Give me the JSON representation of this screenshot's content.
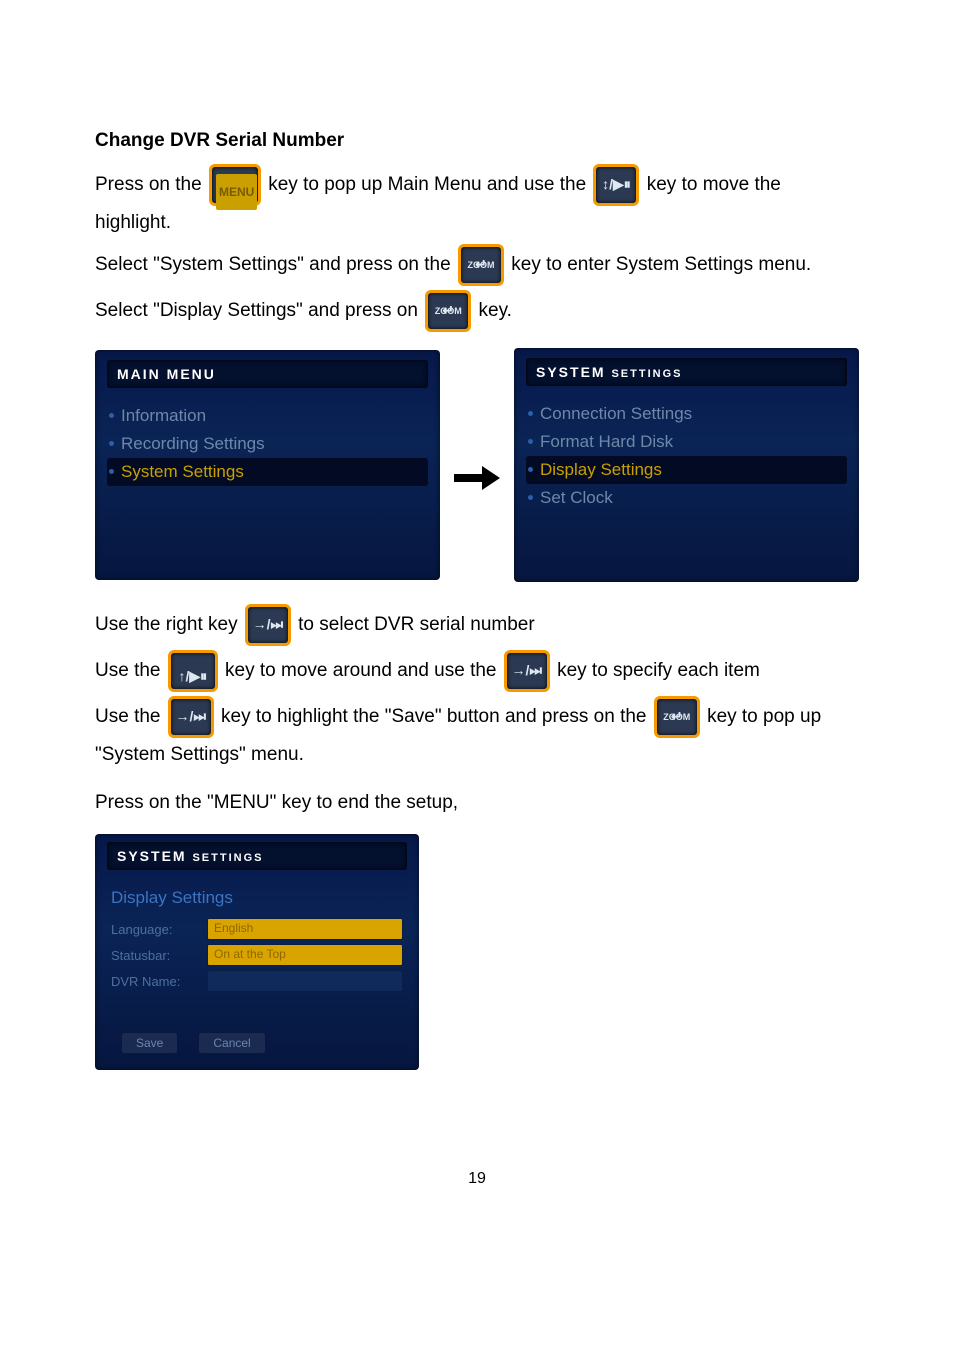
{
  "title": "Change DVR Serial Number",
  "p1": {
    "a": "Press on the",
    "b": "key to pop up Main Menu and use the",
    "c": " key to move the highlight."
  },
  "p2": {
    "a": "Select  \"System Settings\" and press on the",
    "b": "key to enter System Settings menu."
  },
  "p3": {
    "a": "Select  \"Display Settings\" and press on",
    "b": "key."
  },
  "keys": {
    "menu": "MENU",
    "updown": "↕/▶⏸",
    "zoom_top": "ZOOM",
    "zoom_glyph": "↵",
    "right": "→/⏭",
    "tkey": "↑/▶⏸"
  },
  "panel_main": {
    "header": "MAIN MENU",
    "items": [
      "Information",
      "Recording Settings",
      "System Settings"
    ],
    "highlight_index": 2
  },
  "panel_sys": {
    "header_a": "SYSTEM",
    "header_b": "SETTINGS",
    "items": [
      "Connection Settings",
      "Format Hard Disk",
      "Display Settings",
      "Set Clock"
    ],
    "highlight_index": 2
  },
  "p4": {
    "a": "Use the right key",
    "b": "to select DVR serial number"
  },
  "p5": {
    "a": "Use the",
    "b": " key to move around and use the",
    "c": " key to specify each item"
  },
  "p6": {
    "a": "Use the",
    "b": " key to highlight the \"Save\" button and press on the",
    "c": "key to pop up \"System Settings\" menu."
  },
  "p7": "Press on the \"MENU\" key to end the setup,",
  "panel_display": {
    "header_a": "SYSTEM",
    "header_b": "SETTINGS",
    "section": "Display Settings",
    "rows": [
      {
        "label": "Language:",
        "value": "English",
        "hi": true
      },
      {
        "label": "Statusbar:",
        "value": "On at the Top",
        "hi": true
      },
      {
        "label": "DVR Name:",
        "value": "",
        "hi": false
      }
    ],
    "buttons": [
      "Save",
      "Cancel"
    ]
  },
  "page_number": "19"
}
